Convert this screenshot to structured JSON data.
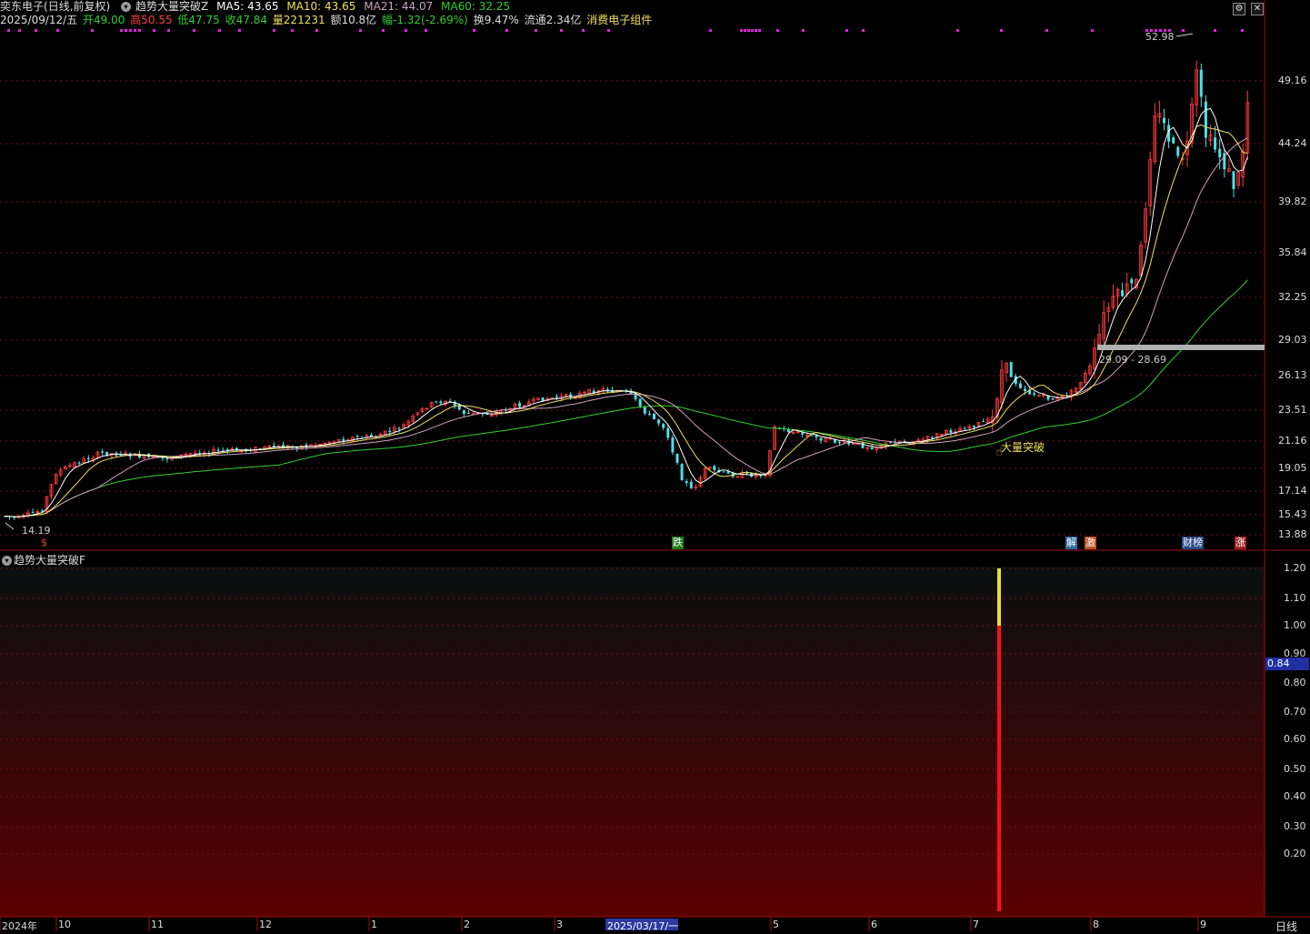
{
  "header": {
    "stock_name": "奕东电子",
    "period_label": "(日线,前复权)",
    "indicator_name": "趋势大量突破Z",
    "ma5": "MA5: 43.65",
    "ma10": "MA10: 43.65",
    "ma21": "MA21: 44.07",
    "ma60": "MA60: 32.25",
    "date": "2025/09/12/五",
    "open": "开49.00",
    "high": "高50.55",
    "low": "低47.75",
    "close": "收47.84",
    "volume": "量221231",
    "amount": "额10.8亿",
    "change": "幅-1.32(-2.69%)",
    "turnover": "换9.47%",
    "float": "流通2.34亿",
    "sector": "消费电子组件"
  },
  "price_axis": [
    "49.16",
    "44.24",
    "39.82",
    "35.84",
    "32.25",
    "29.03",
    "26.13",
    "23.51",
    "21.16",
    "19.05",
    "17.14",
    "15.43",
    "13.88"
  ],
  "annotations": {
    "peak": "52.98",
    "low": "14.19",
    "zone": "29.09 - 28.69",
    "breakout": "大量突破"
  },
  "signals": [
    {
      "text": "$",
      "color": "#ff4040",
      "bg": "transparent"
    },
    {
      "text": "跌",
      "color": "#fff",
      "bg": "#1a7a1a"
    },
    {
      "text": "解",
      "color": "#fff",
      "bg": "#2a6aa0"
    },
    {
      "text": "激",
      "color": "#fff",
      "bg": "#c05020"
    },
    {
      "text": "财榜",
      "color": "#fff",
      "bg": "#2a4a8a"
    },
    {
      "text": "涨",
      "color": "#fff",
      "bg": "#a02020"
    }
  ],
  "sub_panel": {
    "title": "趋势大量突破F",
    "axis": [
      "1.20",
      "1.10",
      "1.00",
      "0.90",
      "0.80",
      "0.70",
      "0.60",
      "0.50",
      "0.40",
      "0.30",
      "0.20"
    ],
    "current": "0.84"
  },
  "time_axis": {
    "labels": [
      "2024年",
      "10",
      "11",
      "12",
      "1",
      "2",
      "3",
      "5",
      "6",
      "7",
      "8",
      "9"
    ],
    "highlight": "2025/03/17/一",
    "period_button": "日线"
  },
  "colors": {
    "up": "#ff3c3c",
    "down": "#4ee0e8",
    "ma5": "#ffffff",
    "ma10": "#f0e060",
    "ma21": "#d0a0c0",
    "ma60": "#30d030"
  }
}
